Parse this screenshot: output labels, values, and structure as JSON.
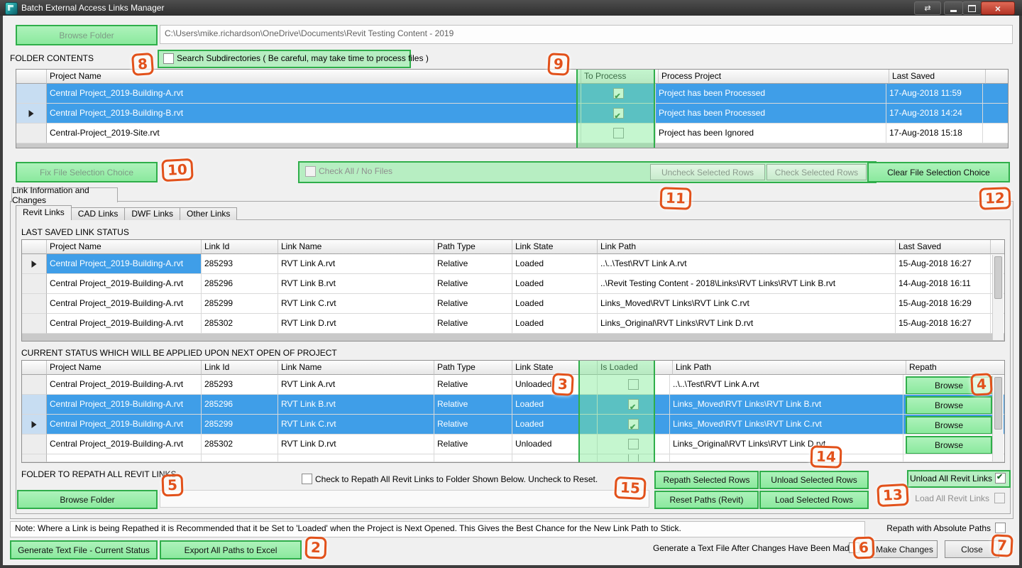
{
  "window": {
    "title": "Batch External Access Links Manager",
    "swap_glyph": "⇄",
    "close_glyph": "×"
  },
  "colors": {
    "selection_blue": "#3f9ee8",
    "highlight_green": "#7eeb94",
    "annotation_orange": "#e2511a",
    "close_red": "#b23325"
  },
  "top": {
    "browse_folder": "Browse Folder",
    "path": "C:\\Users\\mike.richardson\\OneDrive\\Documents\\Revit Testing Content - 2019"
  },
  "folder_contents": {
    "title": "FOLDER CONTENTS",
    "search_subdirs": "Search Subdirectories ( Be careful, may take time to process files )"
  },
  "folder_grid": {
    "columns": {
      "project": "Project Name",
      "to_process": "To Process",
      "process": "Process Project",
      "saved": "Last Saved"
    },
    "rows": [
      {
        "project": "Central Project_2019-Building-A.rvt",
        "checked": true,
        "process": "Project has been Processed",
        "saved": "17-Aug-2018 11:59",
        "selected": true,
        "current": false
      },
      {
        "project": "Central Project_2019-Building-B.rvt",
        "checked": true,
        "process": "Project has been Processed",
        "saved": "17-Aug-2018 14:24",
        "selected": true,
        "current": true
      },
      {
        "project": "Central-Project_2019-Site.rvt",
        "checked": false,
        "process": "Project has been Ignored",
        "saved": "17-Aug-2018 15:18",
        "selected": false,
        "current": false
      }
    ]
  },
  "selection_bar": {
    "fix_file": "Fix File Selection Choice",
    "check_all": "Check All / No Files",
    "uncheck_selected": "Uncheck Selected Rows",
    "check_selected": "Check Selected Rows",
    "clear_file": "Clear File Selection Choice"
  },
  "tabs": {
    "main": "Link Information and Changes",
    "sub": [
      "Revit Links",
      "CAD Links",
      "DWF Links",
      "Other Links"
    ]
  },
  "last_saved_grid": {
    "title": "LAST SAVED LINK STATUS",
    "columns": {
      "project": "Project Name",
      "id": "Link Id",
      "name": "Link Name",
      "path_type": "Path Type",
      "state": "Link State",
      "path": "Link Path",
      "saved": "Last Saved"
    },
    "rows": [
      {
        "project": "Central Project_2019-Building-A.rvt",
        "id": "285293",
        "name": "RVT Link A.rvt",
        "path_type": "Relative",
        "state": "Loaded",
        "path": "..\\..\\Test\\RVT Link A.rvt",
        "saved": "15-Aug-2018 16:27",
        "cell_selected": true,
        "current": true
      },
      {
        "project": "Central Project_2019-Building-A.rvt",
        "id": "285296",
        "name": "RVT Link B.rvt",
        "path_type": "Relative",
        "state": "Loaded",
        "path": "..\\Revit Testing Content - 2018\\Links\\RVT Links\\RVT Link B.rvt",
        "saved": "14-Aug-2018 16:11",
        "cell_selected": false,
        "current": false
      },
      {
        "project": "Central Project_2019-Building-A.rvt",
        "id": "285299",
        "name": "RVT Link C.rvt",
        "path_type": "Relative",
        "state": "Loaded",
        "path": "Links_Moved\\RVT Links\\RVT Link C.rvt",
        "saved": "15-Aug-2018 16:29",
        "cell_selected": false,
        "current": false
      },
      {
        "project": "Central Project_2019-Building-A.rvt",
        "id": "285302",
        "name": "RVT Link D.rvt",
        "path_type": "Relative",
        "state": "Loaded",
        "path": "Links_Original\\RVT Links\\RVT Link D.rvt",
        "saved": "15-Aug-2018 16:27",
        "cell_selected": false,
        "current": false
      }
    ]
  },
  "current_grid": {
    "title": "CURRENT STATUS WHICH WILL BE APPLIED UPON NEXT OPEN OF PROJECT",
    "columns": {
      "project": "Project Name",
      "id": "Link Id",
      "name": "Link Name",
      "path_type": "Path Type",
      "state": "Link State",
      "loaded": "Is Loaded",
      "path": "Link Path",
      "repath": "Repath"
    },
    "browse_label": "Browse",
    "rows": [
      {
        "project": "Central Project_2019-Building-A.rvt",
        "id": "285293",
        "name": "RVT Link A.rvt",
        "path_type": "Relative",
        "state": "Unloaded",
        "loaded": false,
        "path": "..\\..\\Test\\RVT Link A.rvt",
        "selected": false,
        "current": false
      },
      {
        "project": "Central Project_2019-Building-A.rvt",
        "id": "285296",
        "name": "RVT Link B.rvt",
        "path_type": "Relative",
        "state": "Loaded",
        "loaded": true,
        "path": "Links_Moved\\RVT Links\\RVT Link B.rvt",
        "selected": true,
        "current": false
      },
      {
        "project": "Central Project_2019-Building-A.rvt",
        "id": "285299",
        "name": "RVT Link C.rvt",
        "path_type": "Relative",
        "state": "Loaded",
        "loaded": true,
        "path": "Links_Moved\\RVT Links\\RVT Link C.rvt",
        "selected": true,
        "current": true
      },
      {
        "project": "Central Project_2019-Building-A.rvt",
        "id": "285302",
        "name": "RVT Link D.rvt",
        "path_type": "Relative",
        "state": "Unloaded",
        "loaded": false,
        "path": "Links_Original\\RVT Links\\RVT Link D.rvt",
        "selected": false,
        "current": false
      }
    ]
  },
  "repath": {
    "title": "FOLDER TO REPATH ALL REVIT LINKS",
    "check_label": "Check to Repath All Revit Links to Folder Shown Below. Uncheck to Reset.",
    "browse_folder": "Browse Folder",
    "repath_selected": "Repath Selected Rows",
    "unload_selected": "Unload Selected Rows",
    "reset_paths": "Reset Paths (Revit)",
    "load_selected": "Load Selected Rows",
    "unload_all": "Unload All Revit Links",
    "load_all": "Load All Revit Links",
    "unload_all_checked": true,
    "load_all_checked": false
  },
  "footer": {
    "note": "Note: Where a Link is being Repathed it is Recommended that it be Set to 'Loaded' when the Project is Next Opened. This Gives the Best Chance for the New Link Path to Stick.",
    "repath_abs": "Repath with Absolute Paths",
    "gen_text": "Generate Text File - Current Status",
    "export_excel": "Export All Paths to Excel",
    "gen_after": "Generate a Text File After Changes Have Been Made",
    "make_changes": "Make Changes",
    "close": "Close"
  },
  "annotations": {
    "a2": "2",
    "a3": "3",
    "a4": "4",
    "a5": "5",
    "a6": "6",
    "a7": "7",
    "a8": "8",
    "a9": "9",
    "a10": "10",
    "a11": "11",
    "a12": "12",
    "a13": "13",
    "a14": "14",
    "a15": "15"
  }
}
